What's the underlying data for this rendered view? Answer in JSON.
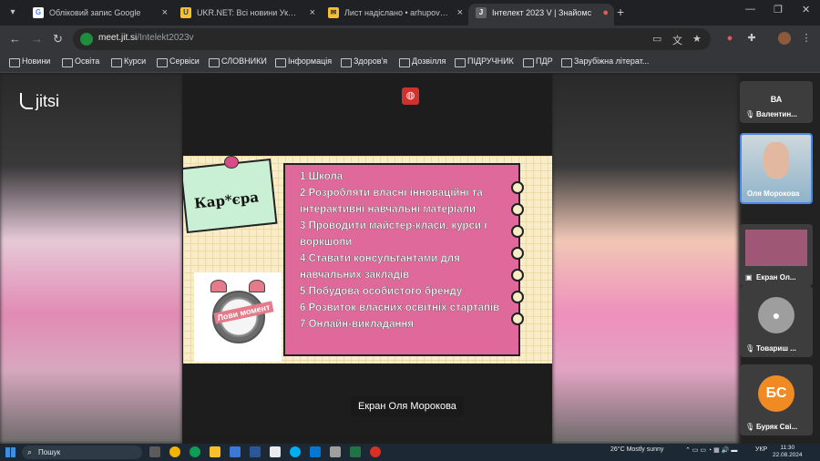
{
  "tabs": [
    {
      "title": "Обліковий запис Google",
      "favicon": "G",
      "color": "#4285f4"
    },
    {
      "title": "UKR.NET: Всі новини України,",
      "favicon": "U",
      "color": "#f6c02d"
    },
    {
      "title": "Лист надіслано • arhupovav@u",
      "favicon": "✉",
      "color": "#f6c02d"
    },
    {
      "title": "Інтелект 2023 V | Знайомс",
      "favicon": "J",
      "color": "#5f6368"
    }
  ],
  "address": {
    "domain": "meet.jit.si",
    "path": "/Intelekt2023v"
  },
  "bookmarks": [
    "Новини",
    "Освіта",
    "Курси",
    "Сервіси",
    "СЛОВНИКИ",
    "Інформація",
    "Здоров'я",
    "Дозвілля",
    "ПІДРУЧНИК",
    "ПДР",
    "Зарубіжна літерат..."
  ],
  "brand": "jitsi",
  "slide": {
    "sticky_title": "Кар*єра",
    "items": [
      "1.Школа",
      "2.Розробляти власні інноваційні та інтерактивні навчальні матеріали",
      "3.Проводити майстер-класи, курси і воркшопи",
      "4.Ставати консультантами для навчальних закладів",
      "5.Побудова особистого бренду",
      "6.Розвиток власних освітніх стартапів",
      "7.Онлайн-викладання"
    ],
    "clock_label": "Лови момент"
  },
  "caption": "Екран Оля Морокова",
  "participants": [
    {
      "name": "Валентин...",
      "initials": "ВА",
      "color": "#e0604f"
    },
    {
      "name": "Оля Морокова",
      "initials": "",
      "color": "#8fb3c9"
    },
    {
      "name": "Екран Ол...",
      "initials": "",
      "color": "#c07a90"
    },
    {
      "name": "Товариш ...",
      "initials": "",
      "color": "#9e9e9e"
    },
    {
      "name": "Буряк Сві...",
      "initials": "БС",
      "color": "#f08a24"
    }
  ],
  "taskbar": {
    "search": "Пошук",
    "weather": "26°C  Mostly sunny",
    "lang": "УКР",
    "time": "11:30",
    "date": "22.08.2024"
  }
}
